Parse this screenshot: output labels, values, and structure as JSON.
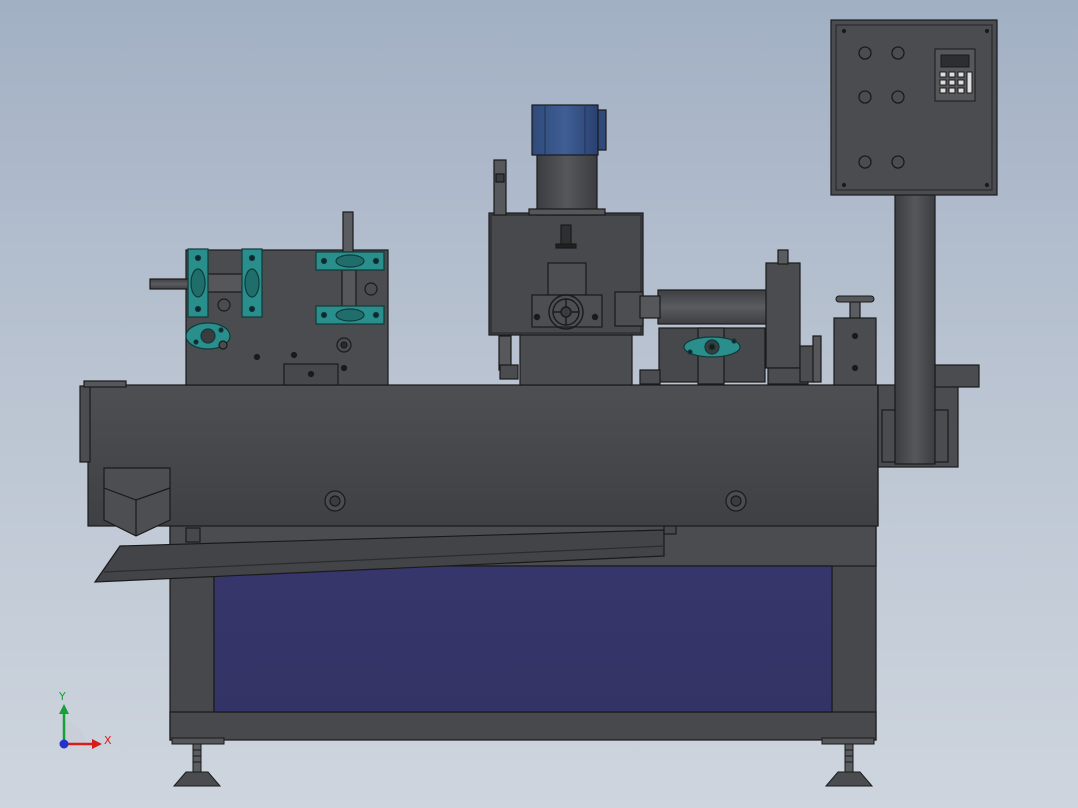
{
  "viewport": {
    "background_top": "#a2b0c4",
    "background_bottom": "#ced5de"
  },
  "machine": {
    "body_color": "#47494c",
    "edge_color": "#1a1a1a",
    "bracket_color": "#2a8f8c",
    "motor_color": "#3a5688",
    "panel_color": "#36366a",
    "control_box": {
      "button_icon": "round-button-icon",
      "display_icon": "controller-display-icon"
    }
  },
  "triad": {
    "x_label": "X",
    "y_label": "Y",
    "x_color": "#d81c1c",
    "y_color": "#18a038",
    "origin_color": "#2233cc"
  }
}
